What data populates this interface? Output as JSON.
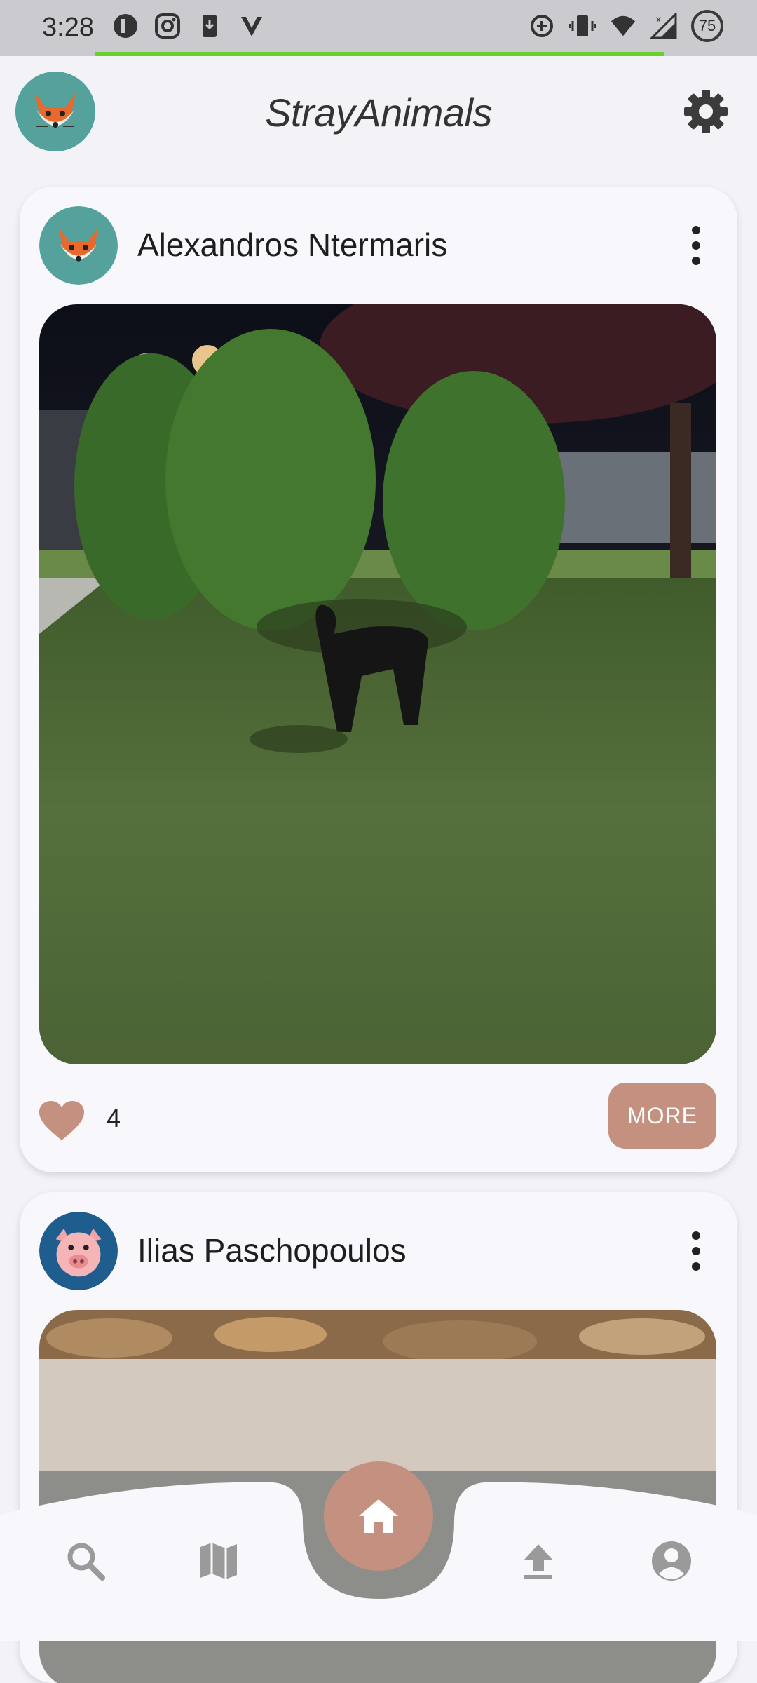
{
  "status_bar": {
    "time": "3:28",
    "battery": "75",
    "left_icons": [
      "app-icon",
      "instagram-icon",
      "download-icon",
      "v-icon"
    ],
    "right_icons": [
      "data-saver-icon",
      "vibrate-icon",
      "wifi-icon",
      "signal-icon"
    ]
  },
  "app": {
    "title": "StrayAnimals",
    "accent_color": "#c49180"
  },
  "posts": [
    {
      "author": "Alexandros Ntermaris",
      "avatar": "fox-icon",
      "likes": "4",
      "more_label": "MORE"
    },
    {
      "author": "Ilias Paschopoulos",
      "avatar": "pig-icon"
    }
  ],
  "nav": {
    "items": [
      "search-icon",
      "map-icon",
      "home-icon",
      "upload-icon",
      "account-icon"
    ],
    "active": "home-icon"
  }
}
